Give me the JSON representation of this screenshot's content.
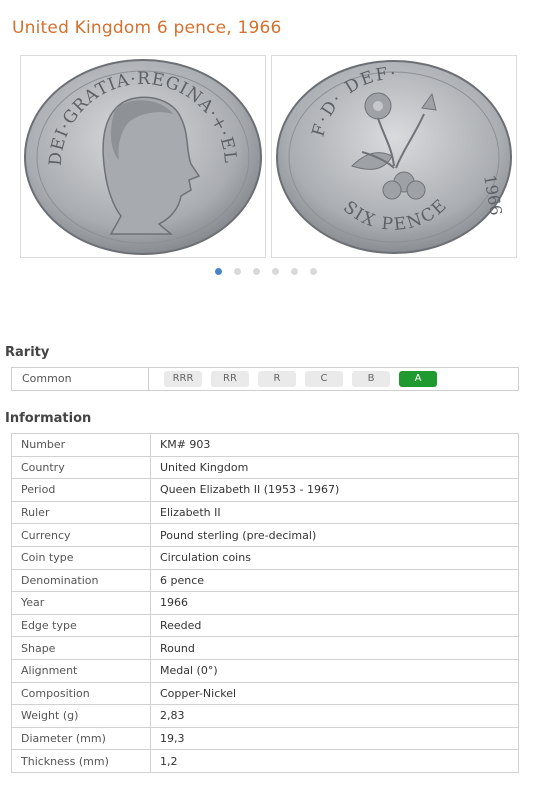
{
  "page": {
    "title": "United Kingdom 6 pence, 1966"
  },
  "gallery": {
    "obverse": {
      "legend": "DEI·GRATIA·REGINA·+·ELIZABETH·II·",
      "icon": "queen-portrait-icon"
    },
    "reverse": {
      "legend_top": "F·D·  DEF·",
      "legend_bottom": "SIX PENCE",
      "year": "1966",
      "icon": "floral-emblem-icon"
    },
    "dots": 6,
    "active_dot": 0
  },
  "rarity": {
    "heading": "Rarity",
    "label": "Common",
    "levels": [
      "RRR",
      "RR",
      "R",
      "C",
      "B",
      "A"
    ],
    "selected": "A",
    "selected_color": "#1f9a2f"
  },
  "information": {
    "heading": "Information",
    "rows": [
      {
        "key": "Number",
        "value": "KM# 903"
      },
      {
        "key": "Country",
        "value": "United Kingdom"
      },
      {
        "key": "Period",
        "value": "Queen Elizabeth II (1953 - 1967)"
      },
      {
        "key": "Ruler",
        "value": "Elizabeth II"
      },
      {
        "key": "Currency",
        "value": "Pound sterling (pre-decimal)"
      },
      {
        "key": "Coin type",
        "value": "Circulation coins"
      },
      {
        "key": "Denomination",
        "value": "6 pence"
      },
      {
        "key": "Year",
        "value": "1966"
      },
      {
        "key": "Edge type",
        "value": "Reeded"
      },
      {
        "key": "Shape",
        "value": "Round"
      },
      {
        "key": "Alignment",
        "value": "Medal (0°)"
      },
      {
        "key": "Composition",
        "value": "Copper-Nickel"
      },
      {
        "key": "Weight (g)",
        "value": "2,83"
      },
      {
        "key": "Diameter (mm)",
        "value": "19,3"
      },
      {
        "key": "Thickness (mm)",
        "value": "1,2"
      }
    ]
  },
  "colors": {
    "title": "#d4712f",
    "active_dot": "#4a84c8",
    "coin_metal": "#b9bcc0"
  }
}
